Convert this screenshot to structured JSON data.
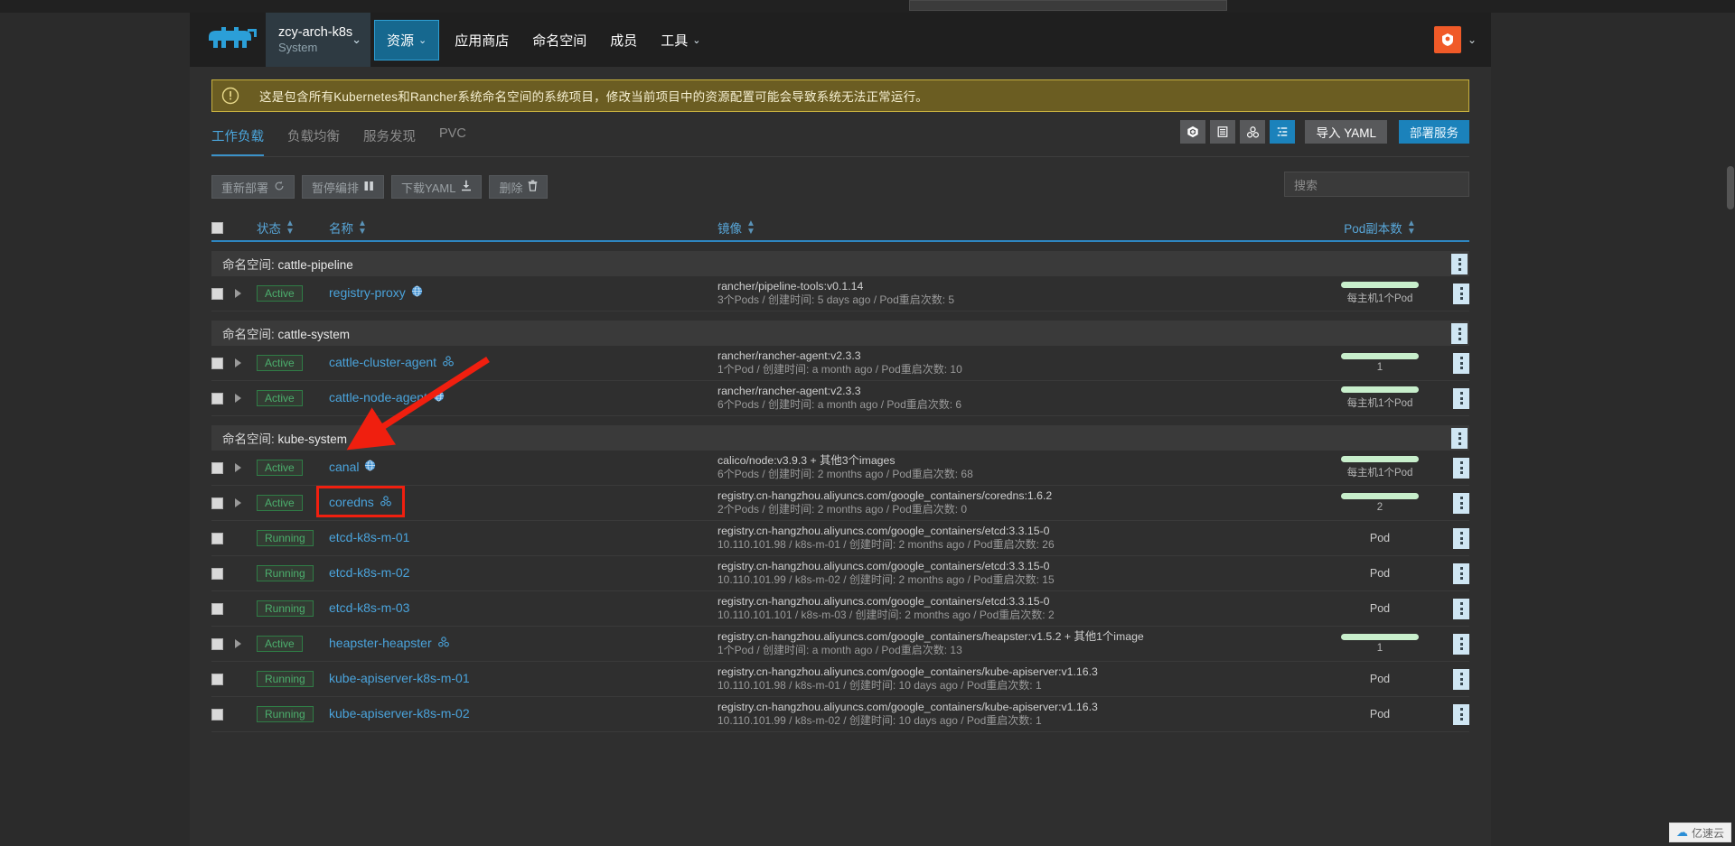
{
  "header": {
    "logo_icon": "rancher-cow-logo",
    "cluster": {
      "name": "zcy-arch-k8s",
      "sub": "System",
      "caret": "⌄"
    },
    "nav": [
      {
        "label": "资源",
        "caret": "⌄",
        "active": true
      },
      {
        "label": "应用商店",
        "caret": "",
        "active": false
      },
      {
        "label": "命名空间",
        "caret": "",
        "active": false
      },
      {
        "label": "成员",
        "caret": "",
        "active": false
      },
      {
        "label": "工具",
        "caret": "⌄",
        "active": false
      }
    ],
    "user_caret": "⌄",
    "accent": "#1b82bb"
  },
  "banner": {
    "icon": "info-circle-icon",
    "text": "这是包含所有Kubernetes和Rancher系统命名空间的系统项目，修改当前项目中的资源配置可能会导致系统无法正常运行。",
    "bg": "#6b5d22",
    "border": "#c8b13f"
  },
  "tabs": [
    {
      "label": "工作负载",
      "active": true
    },
    {
      "label": "负载均衡",
      "active": false
    },
    {
      "label": "服务发现",
      "active": false
    },
    {
      "label": "PVC",
      "active": false
    }
  ],
  "view_tools": [
    {
      "name": "cluster-view-icon",
      "glyph": "⬡",
      "selected": false
    },
    {
      "name": "list-view-icon",
      "glyph": "☰",
      "selected": false
    },
    {
      "name": "group-view-icon",
      "glyph": "☸",
      "selected": false
    },
    {
      "name": "grouped-list-view-icon",
      "glyph": "≡",
      "selected": true
    }
  ],
  "toolbar_buttons": {
    "import_yaml": "导入 YAML",
    "deploy": "部署服务"
  },
  "actions": [
    {
      "label": "重新部署",
      "icon": "redeploy-icon",
      "glyph": "↺"
    },
    {
      "label": "暂停编排",
      "icon": "pause-icon",
      "glyph": "▐▐"
    },
    {
      "label": "下载YAML",
      "icon": "download-icon",
      "glyph": "⤓"
    },
    {
      "label": "删除",
      "icon": "trash-icon",
      "glyph": "Ὕ1"
    }
  ],
  "search": {
    "placeholder": "搜索",
    "value": ""
  },
  "table": {
    "columns": {
      "state": "状态",
      "name": "名称",
      "image": "镜像",
      "pods": "Pod副本数"
    },
    "sort_icon": "↕",
    "namespace_prefix": "命名空间:",
    "groups": [
      {
        "namespace": "cattle-pipeline",
        "rows": [
          {
            "has_expander": true,
            "state": "Active",
            "name": "registry-proxy",
            "name_icon": "globe-icon",
            "image": "rancher/pipeline-tools:v0.1.14",
            "meta": "3个Pods / 创建时间: 5 days ago / Pod重启次数: 5",
            "scale_bar": true,
            "scale_label": "每主机1个Pod"
          }
        ]
      },
      {
        "namespace": "cattle-system",
        "rows": [
          {
            "has_expander": true,
            "state": "Active",
            "name": "cattle-cluster-agent",
            "name_icon": "deployment-icon",
            "image": "rancher/rancher-agent:v2.3.3",
            "meta": "1个Pod / 创建时间: a month ago / Pod重启次数: 10",
            "scale_bar": true,
            "scale_label": "1"
          },
          {
            "has_expander": true,
            "state": "Active",
            "name": "cattle-node-agent",
            "name_icon": "globe-icon",
            "image": "rancher/rancher-agent:v2.3.3",
            "meta": "6个Pods / 创建时间: a month ago / Pod重启次数: 6",
            "scale_bar": true,
            "scale_label": "每主机1个Pod"
          }
        ]
      },
      {
        "namespace": "kube-system",
        "rows": [
          {
            "has_expander": true,
            "state": "Active",
            "name": "canal",
            "name_icon": "globe-icon",
            "image": "calico/node:v3.9.3 + 其他3个images",
            "meta": "6个Pods / 创建时间: 2 months ago / Pod重启次数: 68",
            "scale_bar": true,
            "scale_label": "每主机1个Pod"
          },
          {
            "has_expander": true,
            "state": "Active",
            "name": "coredns",
            "name_icon": "deployment-icon",
            "image": "registry.cn-hangzhou.aliyuncs.com/google_containers/coredns:1.6.2",
            "meta": "2个Pods / 创建时间: 2 months ago / Pod重启次数: 0",
            "scale_bar": true,
            "scale_label": "2",
            "highlighted": true
          },
          {
            "has_expander": false,
            "state": "Running",
            "name": "etcd-k8s-m-01",
            "name_icon": "",
            "image": "registry.cn-hangzhou.aliyuncs.com/google_containers/etcd:3.3.15-0",
            "meta": "10.110.101.98 / k8s-m-01 / 创建时间: 2 months ago / Pod重启次数: 26",
            "scale_bar": false,
            "scale_label": "Pod"
          },
          {
            "has_expander": false,
            "state": "Running",
            "name": "etcd-k8s-m-02",
            "name_icon": "",
            "image": "registry.cn-hangzhou.aliyuncs.com/google_containers/etcd:3.3.15-0",
            "meta": "10.110.101.99 / k8s-m-02 / 创建时间: 2 months ago / Pod重启次数: 15",
            "scale_bar": false,
            "scale_label": "Pod"
          },
          {
            "has_expander": false,
            "state": "Running",
            "name": "etcd-k8s-m-03",
            "name_icon": "",
            "image": "registry.cn-hangzhou.aliyuncs.com/google_containers/etcd:3.3.15-0",
            "meta": "10.110.101.101 / k8s-m-03 / 创建时间: 2 months ago / Pod重启次数: 2",
            "scale_bar": false,
            "scale_label": "Pod"
          },
          {
            "has_expander": true,
            "state": "Active",
            "name": "heapster-heapster",
            "name_icon": "deployment-icon",
            "image": "registry.cn-hangzhou.aliyuncs.com/google_containers/heapster:v1.5.2 + 其他1个image",
            "meta": "1个Pod / 创建时间: a month ago / Pod重启次数: 13",
            "scale_bar": true,
            "scale_label": "1"
          },
          {
            "has_expander": false,
            "state": "Running",
            "name": "kube-apiserver-k8s-m-01",
            "name_icon": "",
            "image": "registry.cn-hangzhou.aliyuncs.com/google_containers/kube-apiserver:v1.16.3",
            "meta": "10.110.101.98 / k8s-m-01 / 创建时间: 10 days ago / Pod重启次数: 1",
            "scale_bar": false,
            "scale_label": "Pod"
          },
          {
            "has_expander": false,
            "state": "Running",
            "name": "kube-apiserver-k8s-m-02",
            "name_icon": "",
            "image": "registry.cn-hangzhou.aliyuncs.com/google_containers/kube-apiserver:v1.16.3",
            "meta": "10.110.101.99 / k8s-m-02 / 创建时间: 10 days ago / Pod重启次数: 1",
            "scale_bar": false,
            "scale_label": "Pod"
          }
        ]
      }
    ]
  },
  "annotation": {
    "highlight_color": "#f01f0f",
    "target": "coredns"
  },
  "watermark": {
    "text": "亿速云",
    "icon": "cloud-icon"
  }
}
